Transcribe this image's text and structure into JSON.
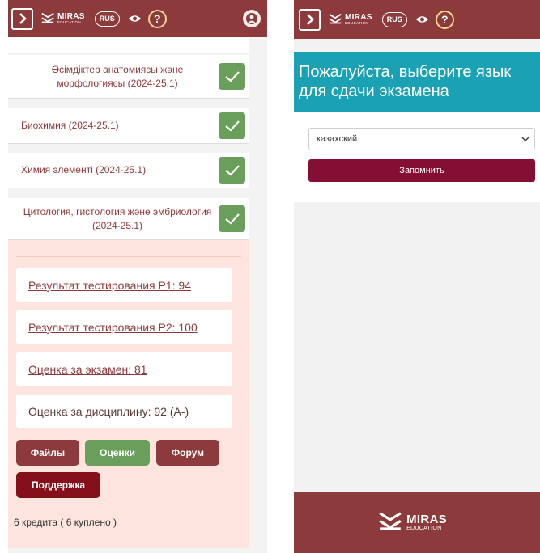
{
  "colors": {
    "brand": "#8c3a3c",
    "success": "#6a9e5b",
    "teal": "#1ba1b4",
    "detail_bg": "#fde4df",
    "primary_btn": "#850f34"
  },
  "header": {
    "brand_title": "MIRAS",
    "brand_sub": "EDUCATION",
    "lang_label": "RUS",
    "help_label": "?"
  },
  "courses": [
    {
      "name": "Өсімдіктер анатомиясы және морфологиясы (2024-25.1)"
    },
    {
      "name": "Биохимия (2024-25.1)"
    },
    {
      "name": "Химия элементі (2024-25.1)"
    },
    {
      "name": "Цитология, гистология және эмбриология (2024-25.1)"
    }
  ],
  "details": {
    "result_p1": "Результат тестирования Р1: 94",
    "result_p2": "Результат тестирования Р2: 100",
    "exam_grade": "Оценка за экзамен: 81",
    "discipline_grade": "Оценка за дисциплину: 92 (A-)",
    "buttons": {
      "files": "Файлы",
      "grades": "Оценки",
      "forum": "Форум",
      "support": "Поддержка"
    },
    "credits": "6 кредита ( 6 куплено )"
  },
  "language_dialog": {
    "title": "Пожалуйста, выберите язык для сдачи экзамена",
    "selected": "казахский",
    "save_label": "Запомнить"
  },
  "footer": {
    "brand_title": "MIRAS",
    "brand_sub": "EDUCATION"
  }
}
